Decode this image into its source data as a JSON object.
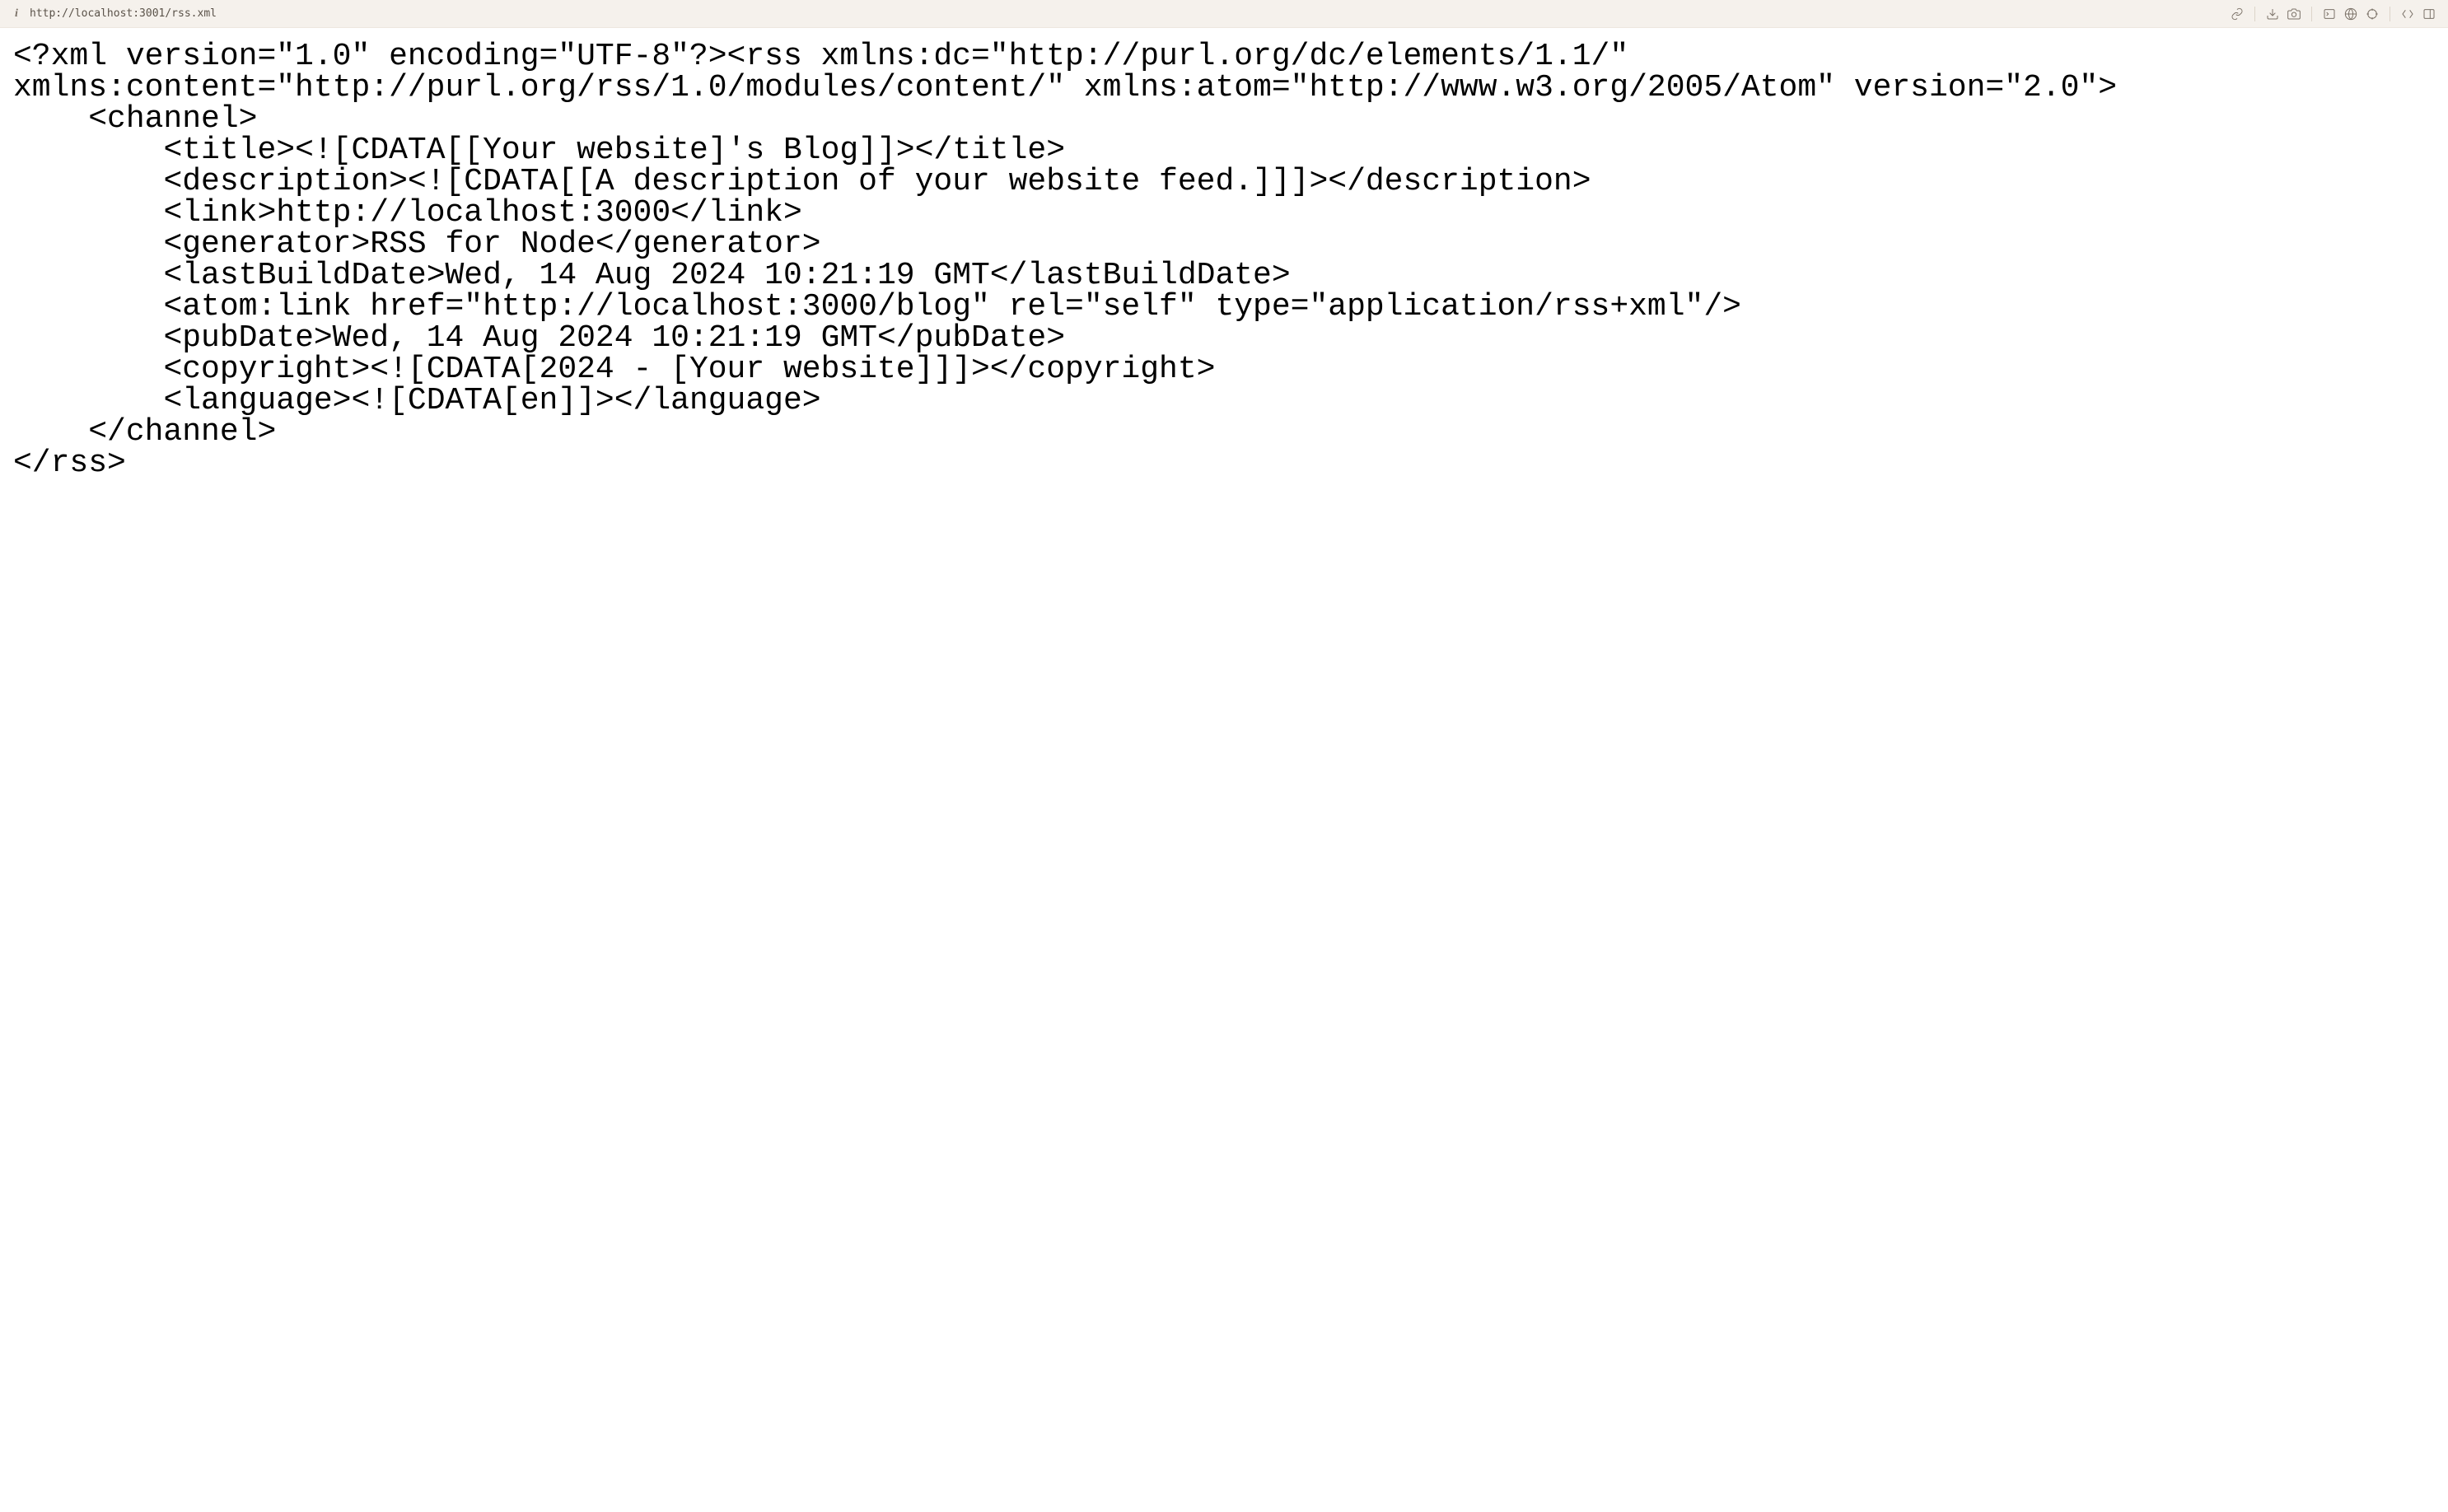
{
  "toolbar": {
    "url": "http://localhost:3001/rss.xml"
  },
  "xml": {
    "line1": "<?xml version=\"1.0\" encoding=\"UTF-8\"?><rss xmlns:dc=\"http://purl.org/dc/elements/1.1/\" xmlns:content=\"http://purl.org/rss/1.0/modules/content/\" xmlns:atom=\"http://www.w3.org/2005/Atom\" version=\"2.0\">",
    "line2": "    <channel>",
    "line3": "        <title><![CDATA[[Your website]'s Blog]]></title>",
    "line4": "        <description><![CDATA[[A description of your website feed.]]]></description>",
    "line5": "        <link>http://localhost:3000</link>",
    "line6": "        <generator>RSS for Node</generator>",
    "line7": "        <lastBuildDate>Wed, 14 Aug 2024 10:21:19 GMT</lastBuildDate>",
    "line8": "        <atom:link href=\"http://localhost:3000/blog\" rel=\"self\" type=\"application/rss+xml\"/>",
    "line9": "        <pubDate>Wed, 14 Aug 2024 10:21:19 GMT</pubDate>",
    "line10": "        <copyright><![CDATA[2024 - [Your website]]]></copyright>",
    "line11": "        <language><![CDATA[en]]></language>",
    "line12": "    </channel>",
    "line13": "</rss>"
  }
}
